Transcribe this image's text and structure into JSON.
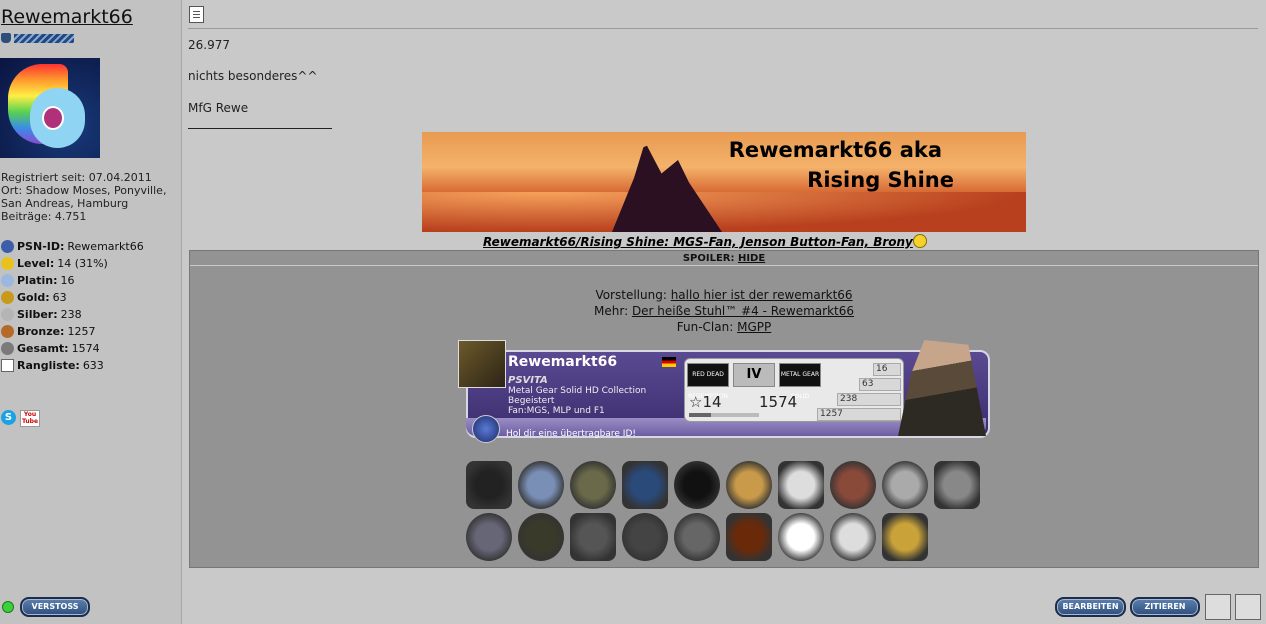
{
  "user": {
    "name": "Rewemarkt66",
    "registered": "Registriert seit: 07.04.2011",
    "location": "Ort: Shadow Moses, Ponyville, San Andreas, Hamburg",
    "posts": "Beiträge: 4.751"
  },
  "stats": [
    {
      "label": "PSN-ID:",
      "value": "Rewemarkt66",
      "color": "#3c5ea8"
    },
    {
      "label": "Level:",
      "value": "14 (31%)",
      "color": "#e8c31c"
    },
    {
      "label": "Platin:",
      "value": "16",
      "color": "#9bb8e0"
    },
    {
      "label": "Gold:",
      "value": "63",
      "color": "#c79a1a"
    },
    {
      "label": "Silber:",
      "value": "238",
      "color": "#b5b5b5"
    },
    {
      "label": "Bronze:",
      "value": "1257",
      "color": "#b56a2a"
    },
    {
      "label": "Gesamt:",
      "value": "1574",
      "color": "#7a7a7a"
    },
    {
      "label": "Rangliste:",
      "value": "633",
      "color": "#ffffff"
    }
  ],
  "social": {
    "skype": "S",
    "youtube": "You Tube"
  },
  "buttons": {
    "report": "VERSTOSS",
    "edit": "BEARBEITEN",
    "quote": "ZITIEREN"
  },
  "post": {
    "line1": "26.977",
    "line2": "nichts besonderes^^",
    "line3": "MfG Rewe"
  },
  "signature": {
    "banner_line1": "Rewemarkt66 aka",
    "banner_line2": "Rising Shine",
    "caption": "Rewemarkt66/Rising Shine: MGS-Fan, Jenson Button-Fan, Brony",
    "spoiler_label": "SPOILER:",
    "spoiler_toggle": "HIDE",
    "intro_label": "Vorstellung:",
    "intro_link": "hallo hier ist der rewemarkt66",
    "more_label": "Mehr:",
    "more_link": "Der heiße Stuhl™ #4 - Rewemarkt66",
    "clan_label": "Fun-Clan:",
    "clan_link": "MGPP"
  },
  "psn_card": {
    "name": "Rewemarkt66",
    "platform": "PSVITA",
    "game": "Metal Gear Solid HD Collection",
    "mood": "Begeistert",
    "fan": "Fan:MGS, MLP und F1",
    "cta": "Hol dir eine übertragbare ID!",
    "level": "14",
    "total": "1574",
    "level_progress": 0.31,
    "platinum": "16",
    "gold": "63",
    "silver": "238",
    "bronze": "1257",
    "games": [
      "RED DEAD REDEMPTION",
      "IV",
      "METAL GEAR SOLID"
    ]
  }
}
